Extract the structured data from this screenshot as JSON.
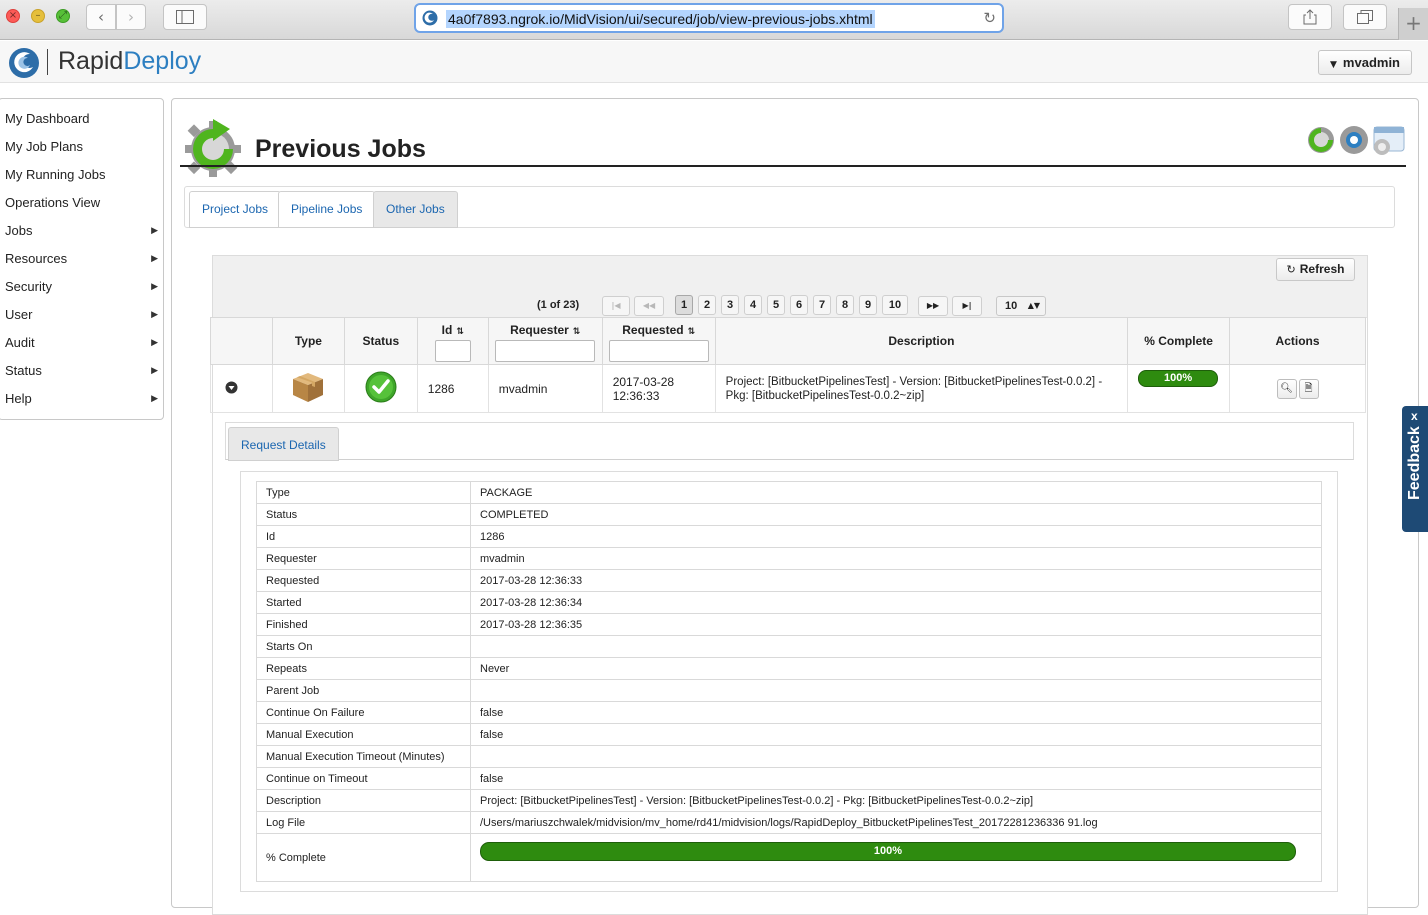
{
  "browser": {
    "url": "4a0f7893.ngrok.io/MidVision/ui/secured/job/view-previous-jobs.xhtml"
  },
  "app": {
    "brand_part1": "Rapid",
    "brand_part2": "Deploy",
    "user": "mvadmin"
  },
  "menu": {
    "items": [
      {
        "label": "My Dashboard",
        "has_submenu": false
      },
      {
        "label": "My Job Plans",
        "has_submenu": false
      },
      {
        "label": "My Running Jobs",
        "has_submenu": false
      },
      {
        "label": "Operations View",
        "has_submenu": false
      },
      {
        "label": "Jobs",
        "has_submenu": true
      },
      {
        "label": "Resources",
        "has_submenu": true
      },
      {
        "label": "Security",
        "has_submenu": true
      },
      {
        "label": "User",
        "has_submenu": true
      },
      {
        "label": "Audit",
        "has_submenu": true
      },
      {
        "label": "Status",
        "has_submenu": true
      },
      {
        "label": "Help",
        "has_submenu": true
      }
    ]
  },
  "page": {
    "title": "Previous Jobs",
    "tabs": [
      "Project Jobs",
      "Pipeline Jobs",
      "Other Jobs"
    ],
    "active_tab": "Other Jobs"
  },
  "toolbar": {
    "refresh_label": "Refresh"
  },
  "paginator": {
    "label": "(1 of 23)",
    "pages": [
      "1",
      "2",
      "3",
      "4",
      "5",
      "6",
      "7",
      "8",
      "9",
      "10"
    ],
    "current_page": "1",
    "rows_per_page": "10"
  },
  "table": {
    "headers": {
      "type": "Type",
      "status": "Status",
      "id": "Id",
      "requester": "Requester",
      "requested": "Requested",
      "description": "Description",
      "complete": "% Complete",
      "actions": "Actions"
    },
    "rows": [
      {
        "id": "1286",
        "requester": "mvadmin",
        "requested_date": "2017-03-28",
        "requested_time": "12:36:33",
        "description": "Project: [BitbucketPipelinesTest] - Version: [BitbucketPipelinesTest-0.0.2] - Pkg: [BitbucketPipelinesTest-0.0.2~zip]",
        "complete": "100%",
        "complete_fraction": 1.0
      }
    ]
  },
  "details": {
    "tab_label": "Request Details",
    "rows": [
      {
        "key": "Type",
        "value": "PACKAGE"
      },
      {
        "key": "Status",
        "value": "COMPLETED"
      },
      {
        "key": "Id",
        "value": "1286"
      },
      {
        "key": "Requester",
        "value": "mvadmin"
      },
      {
        "key": "Requested",
        "value": "2017-03-28 12:36:33"
      },
      {
        "key": "Started",
        "value": "2017-03-28 12:36:34"
      },
      {
        "key": "Finished",
        "value": "2017-03-28 12:36:35"
      },
      {
        "key": "Starts On",
        "value": ""
      },
      {
        "key": "Repeats",
        "value": "Never"
      },
      {
        "key": "Parent Job",
        "value": ""
      },
      {
        "key": "Continue On Failure",
        "value": "false"
      },
      {
        "key": "Manual Execution",
        "value": "false"
      },
      {
        "key": "Manual Execution Timeout (Minutes)",
        "value": ""
      },
      {
        "key": "Continue on Timeout",
        "value": "false"
      },
      {
        "key": "Description",
        "value": "Project: [BitbucketPipelinesTest] - Version: [BitbucketPipelinesTest-0.0.2] - Pkg: [BitbucketPipelinesTest-0.0.2~zip]"
      },
      {
        "key": "Log File",
        "value": "/Users/mariuszchwalek/midvision/mv_home/rd41/midvision/logs/RapidDeploy_BitbucketPipelinesTest_20172281236336 91.log"
      }
    ],
    "complete_key": "% Complete",
    "complete_value": "100%",
    "complete_fraction": 1.0
  },
  "feedback": {
    "label": "Feedback",
    "close": "x"
  },
  "colors": {
    "accent_blue": "#2d7fc1",
    "link_blue": "#1b66b0",
    "progress_green": "#2e8b0f",
    "feedback_bg": "#1e4a75"
  }
}
